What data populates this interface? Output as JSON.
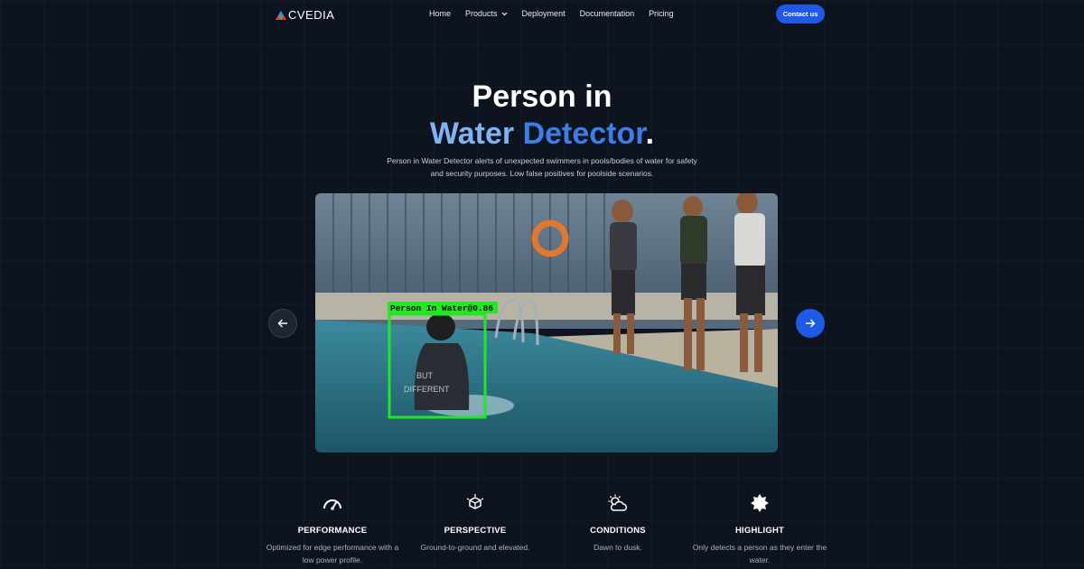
{
  "nav": {
    "logo_text": "CVEDIA",
    "links": [
      {
        "label": "Home"
      },
      {
        "label": "Products"
      },
      {
        "label": "Deployment"
      },
      {
        "label": "Documentation"
      },
      {
        "label": "Pricing"
      }
    ],
    "contact_label": "Contact us"
  },
  "hero": {
    "title_line1": "Person in",
    "title_word_a": "Water",
    "title_word_b": "Detector",
    "title_dot": ".",
    "subtitle": "Person in Water Detector alerts of unexpected swimmers in pools/bodies of water for safety and security purposes. Low false positives for poolside scenarios.",
    "detection_label": "Person In Water@0.86",
    "shirt_text_1": "BUT",
    "shirt_text_2": "DIFFERENT"
  },
  "features": [
    {
      "icon": "speedometer-icon",
      "title": "PERFORMANCE",
      "desc": "Optimized for edge performance with a low power profile."
    },
    {
      "icon": "cube-icon",
      "title": "PERSPECTIVE",
      "desc": "Ground-to-ground and elevated."
    },
    {
      "icon": "sun-cloud-icon",
      "title": "CONDITIONS",
      "desc": "Dawn to dusk."
    },
    {
      "icon": "star-badge-icon",
      "title": "HIGHLIGHT",
      "desc": "Only detects a person as they enter the water."
    }
  ],
  "colors": {
    "background": "#0e1320",
    "accent": "#1f5ae6",
    "title_light_blue": "#7fb3f2",
    "title_blue": "#3d7ee6",
    "detection_box": "#22e822"
  }
}
